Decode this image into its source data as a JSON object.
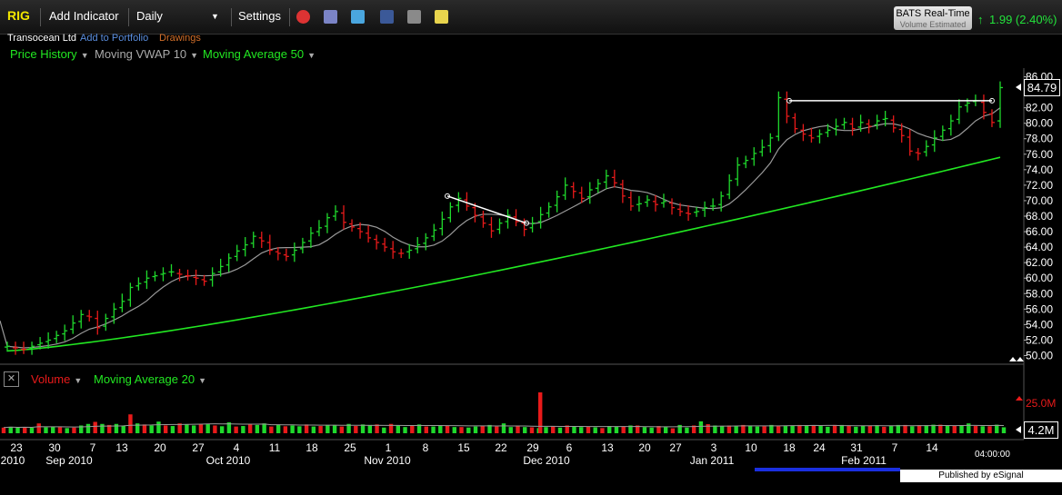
{
  "toolbar": {
    "symbol": "RIG",
    "add_indicator": "Add Indicator",
    "interval": "Daily",
    "settings": "Settings",
    "icons": [
      "alarm-clock-icon",
      "book-icon",
      "twitter-icon",
      "facebook-icon",
      "camera-icon",
      "note-icon"
    ]
  },
  "sub": {
    "company": "Transocean Ltd",
    "add_portfolio": "Add to Portfolio",
    "drawings": "Drawings"
  },
  "indicators": [
    "Price History",
    "Moving VWAP 10",
    "Moving Average 50"
  ],
  "realtime": {
    "title": "BATS Real-Time",
    "subtitle": "Volume Estimated",
    "change": "1.99 (2.40%)"
  },
  "price_label": "84.79",
  "volume_panel": {
    "labels": [
      "Volume",
      "Moving Average 20"
    ],
    "scale_max": "25.0M",
    "current": "4.2M"
  },
  "time_label": "04:00:00",
  "published": "Published by eSignal (www.esignal.com)",
  "colors": {
    "up": "#1fd92c",
    "down": "#e81a1a",
    "ma50": "#22e822",
    "vwap": "#9a9a9a",
    "price_label_green": "#23e23b"
  },
  "chart_data": {
    "type": "ohlc",
    "y_ticks": [
      "86.00",
      "84.00",
      "82.00",
      "80.00",
      "78.00",
      "76.00",
      "74.00",
      "72.00",
      "70.00",
      "68.00",
      "66.00",
      "64.00",
      "62.00",
      "60.00",
      "58.00",
      "56.00",
      "54.00",
      "52.00",
      "50.00"
    ],
    "ylim": [
      50,
      86
    ],
    "x_day_labels": [
      "23",
      "30",
      "7",
      "13",
      "20",
      "27",
      "4",
      "11",
      "18",
      "25",
      "1",
      "8",
      "15",
      "22",
      "29",
      "6",
      "13",
      "20",
      "27",
      "3",
      "10",
      "18",
      "24",
      "31",
      "7",
      "14"
    ],
    "x_month_labels": [
      "2010",
      "Sep 2010",
      "Oct 2010",
      "Nov 2010",
      "Dec 2010",
      "Jan 2011",
      "Feb 2011"
    ],
    "closes": [
      51.2,
      51.0,
      50.8,
      51.2,
      51.6,
      52.0,
      52.6,
      53.2,
      54.2,
      55.3,
      55.0,
      53.6,
      54.8,
      56.0,
      57.0,
      58.8,
      59.3,
      60.0,
      60.3,
      60.6,
      60.8,
      60.5,
      60.3,
      60.0,
      59.6,
      60.6,
      61.5,
      62.6,
      63.5,
      64.3,
      65.4,
      64.8,
      63.6,
      63.2,
      62.8,
      63.6,
      64.6,
      65.8,
      66.5,
      67.8,
      68.6,
      67.2,
      66.6,
      66.0,
      65.2,
      64.6,
      64.0,
      63.4,
      63.2,
      63.6,
      64.3,
      65.2,
      66.2,
      67.6,
      69.2,
      70.3,
      69.3,
      68.1,
      67.1,
      66.1,
      67.1,
      68.1,
      67.3,
      66.3,
      67.1,
      68.2,
      69.2,
      70.5,
      72.0,
      71.2,
      70.3,
      71.4,
      72.2,
      73.2,
      72.3,
      70.6,
      69.3,
      69.6,
      70.1,
      69.5,
      69.9,
      69.1,
      68.6,
      68.3,
      68.6,
      69.1,
      69.3,
      70.6,
      72.6,
      74.6,
      75.2,
      76.1,
      76.9,
      78.1,
      83.3,
      80.9,
      79.3,
      78.6,
      78.1,
      78.6,
      79.1,
      79.6,
      80.1,
      79.3,
      80.1,
      79.6,
      80.3,
      80.6,
      79.4,
      78.4,
      76.4,
      76.1,
      77.0,
      78.1,
      79.1,
      80.3,
      82.1,
      82.6,
      82.9,
      81.4,
      80.1,
      84.6
    ],
    "volume": [
      2.2,
      2.5,
      2.2,
      2.4,
      2.1,
      3.8,
      2.3,
      2.6,
      2.4,
      2.0,
      2.2,
      3.0,
      3.6,
      4.4,
      3.6,
      3.2,
      3.6,
      3.0,
      7.3,
      3.8,
      3.4,
      3.0,
      4.5,
      3.0,
      2.8,
      3.8,
      3.4,
      3.0,
      3.6,
      3.5,
      3.0,
      2.7,
      4.2,
      2.6,
      2.8,
      3.6,
      3.2,
      3.8,
      2.6,
      3.2,
      2.7,
      3.0,
      2.7,
      3.4,
      2.6,
      2.8,
      3.2,
      3.0,
      2.6,
      3.6,
      2.8,
      3.4,
      3.2,
      3.4,
      2.2,
      3.6,
      3.0,
      2.4,
      2.8,
      3.4,
      2.6,
      2.6,
      2.8,
      3.0,
      2.4,
      2.4,
      2.2,
      2.6,
      2.8,
      3.2,
      2.6,
      3.8,
      2.4,
      3.0,
      2.4,
      2.3,
      2.0,
      2.4,
      2.6,
      2.2,
      3.0,
      2.8,
      2.4,
      2.6,
      2.3,
      2.0,
      2.8,
      2.6,
      2.7,
      3.0,
      3.0,
      2.4,
      2.2,
      2.8,
      2.4,
      1.9,
      3.2,
      2.2,
      3.0,
      4.6,
      3.5,
      3.0,
      2.8,
      3.0,
      2.8,
      3.2,
      3.0,
      2.6,
      2.7,
      3.2,
      2.8,
      2.8,
      3.0,
      3.2,
      2.9,
      3.0,
      2.8,
      2.5,
      3.2,
      3.2,
      3.0,
      2.5,
      2.9,
      3.0,
      3.1,
      2.5,
      2.8,
      3.2,
      3.2,
      2.7,
      3.1,
      3.1,
      3.3,
      3.3,
      2.9,
      2.9,
      3.1,
      3.8,
      2.8,
      2.7,
      2.7,
      3.3,
      2.3
    ],
    "vol_spike": {
      "index": 86,
      "value": 12.5
    },
    "resistance_line": [
      82.9,
      82.9
    ],
    "trend_line": [
      70.6,
      67.1
    ]
  }
}
